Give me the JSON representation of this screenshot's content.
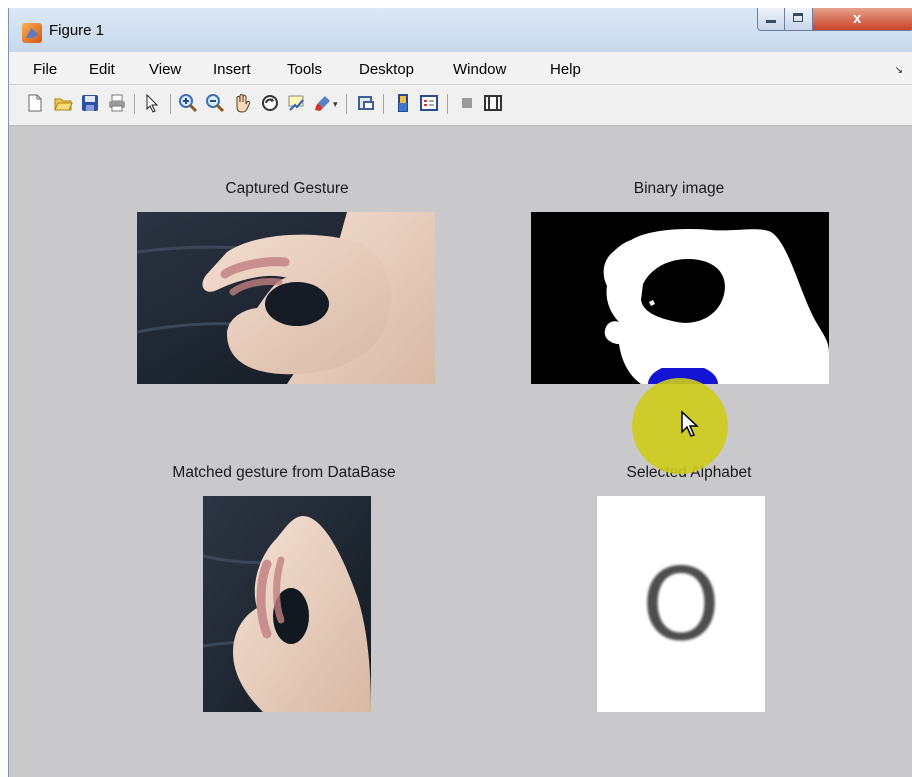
{
  "window": {
    "title": "Figure 1",
    "close_glyph": "x"
  },
  "menu": {
    "items": [
      "File",
      "Edit",
      "View",
      "Insert",
      "Tools",
      "Desktop",
      "Window",
      "Help"
    ],
    "overflow": "↘"
  },
  "toolbar": {
    "icons": [
      "new-figure-icon",
      "open-file-icon",
      "save-icon",
      "print-icon",
      "pointer-icon",
      "zoom-in-icon",
      "zoom-out-icon",
      "pan-hand-icon",
      "rotate-3d-icon",
      "data-cursor-icon",
      "brush-icon",
      "link-plot-icon",
      "colorbar-icon",
      "legend-icon",
      "hide-plot-tools-icon",
      "show-plot-tools-icon"
    ]
  },
  "panels": {
    "captured": {
      "title": "Captured Gesture"
    },
    "binary": {
      "title": "Binary image"
    },
    "matched": {
      "title": "Matched gesture from DataBase"
    },
    "alphabet": {
      "title": "Selected Alphabet",
      "letter": "O"
    }
  },
  "colors": {
    "figure_bg": "#c9c9cc",
    "highlight": "#cecc18",
    "marker_blue": "#1414d4"
  }
}
